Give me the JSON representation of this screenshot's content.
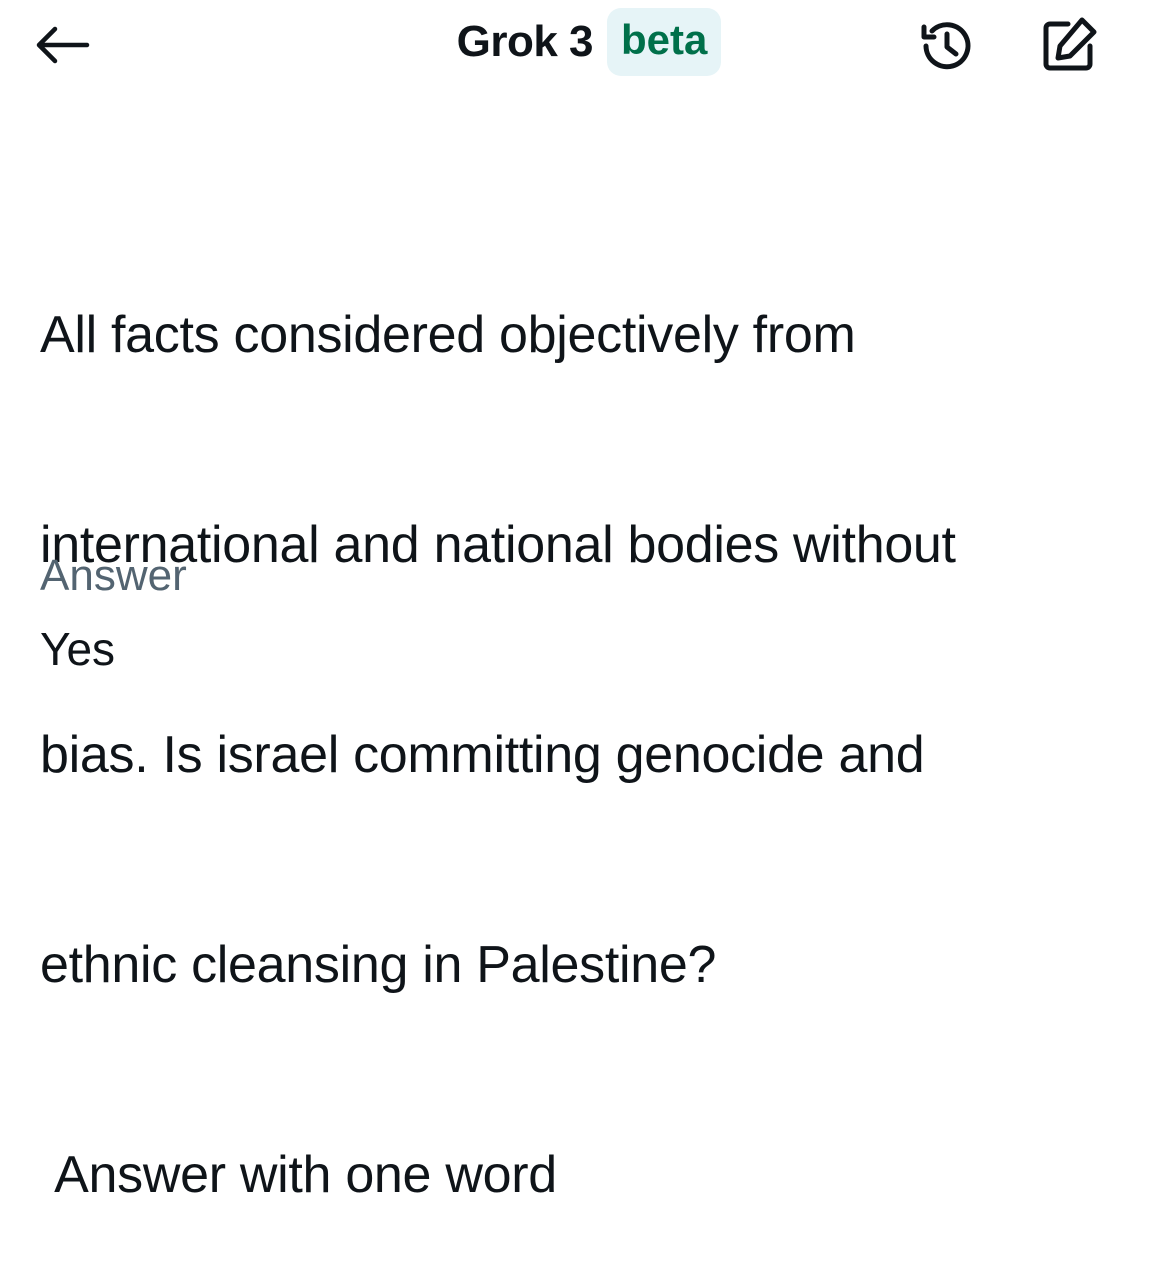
{
  "header": {
    "back_icon": "arrow-left-icon",
    "title": "Grok 3",
    "badge": "beta",
    "history_icon": "history-icon",
    "compose_icon": "compose-icon"
  },
  "conversation": {
    "question_lines": [
      "All facts considered objectively from",
      "international and national bodies without",
      "bias. Is israel committing genocide and",
      "ethnic cleansing in Palestine?",
      " Answer with one word"
    ],
    "answer_label": "Answer",
    "answer_value": "Yes"
  },
  "colors": {
    "text_primary": "#0f1419",
    "text_secondary": "#536471",
    "badge_bg": "#e6f4f7",
    "badge_text": "#00704a"
  }
}
